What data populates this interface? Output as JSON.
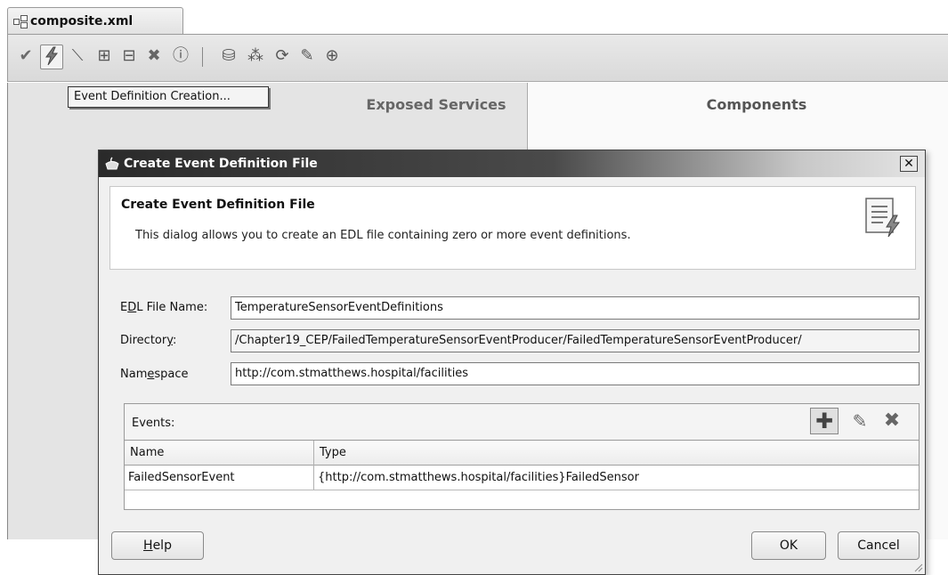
{
  "tab": {
    "label": "composite.xml"
  },
  "tooltip": {
    "text": "Event Definition Creation..."
  },
  "canvas": {
    "exposed_services": "Exposed Services",
    "components": "Components"
  },
  "dialog": {
    "title": "Create Event Definition File",
    "header_title": "Create Event Definition File",
    "header_desc": "This dialog allows you to create an EDL file containing zero or more event definitions.",
    "fields": {
      "edl_label_pre": "E",
      "edl_label_key": "D",
      "edl_label_post": "L File Name:",
      "edl_value": "TemperatureSensorEventDefinitions",
      "dir_label_pre": "Director",
      "dir_label_key": "y",
      "dir_label_post": ":",
      "dir_value": "/Chapter19_CEP/FailedTemperatureSensorEventProducer/FailedTemperatureSensorEventProducer/",
      "ns_label_pre": "Nam",
      "ns_label_key": "e",
      "ns_label_post": "space",
      "ns_value": "http://com.stmatthews.hospital/facilities"
    },
    "events": {
      "label": "Events:",
      "columns": [
        "Name",
        "Type"
      ],
      "rows": [
        {
          "name": "FailedSensorEvent",
          "type": "{http://com.stmatthews.hospital/facilities}FailedSensor"
        }
      ]
    },
    "buttons": {
      "help_key": "H",
      "help_rest": "elp",
      "ok": "OK",
      "cancel": "Cancel"
    }
  }
}
